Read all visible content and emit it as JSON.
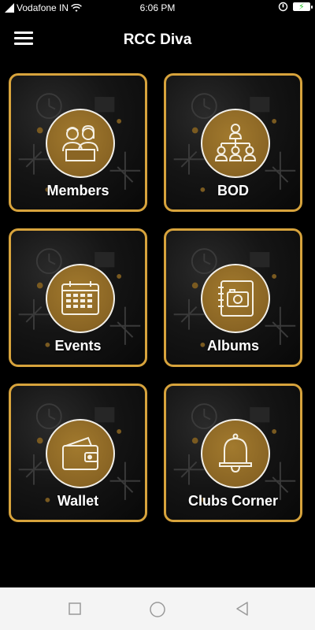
{
  "status_bar": {
    "carrier": "Vodafone IN",
    "time": "6:06 PM",
    "icons": [
      "signal-icon",
      "wifi-icon",
      "alarm-icon",
      "battery-icon"
    ]
  },
  "app_bar": {
    "title": "RCC Diva",
    "menu_icon": "hamburger-menu-icon"
  },
  "tiles": [
    {
      "label": "Members",
      "icon": "members-icon"
    },
    {
      "label": "BOD",
      "icon": "org-chart-icon"
    },
    {
      "label": "Events",
      "icon": "calendar-icon"
    },
    {
      "label": "Albums",
      "icon": "photo-album-icon"
    },
    {
      "label": "Wallet",
      "icon": "wallet-icon"
    },
    {
      "label": "Clubs Corner",
      "icon": "bell-icon"
    }
  ],
  "nav_bar": {
    "buttons": [
      "recent-apps-icon",
      "home-icon",
      "back-icon"
    ]
  },
  "colors": {
    "background": "#000000",
    "tile_border": "#d7a33c",
    "circle_gold": "#8a6524",
    "nav_bar": "#f4f4f4"
  }
}
